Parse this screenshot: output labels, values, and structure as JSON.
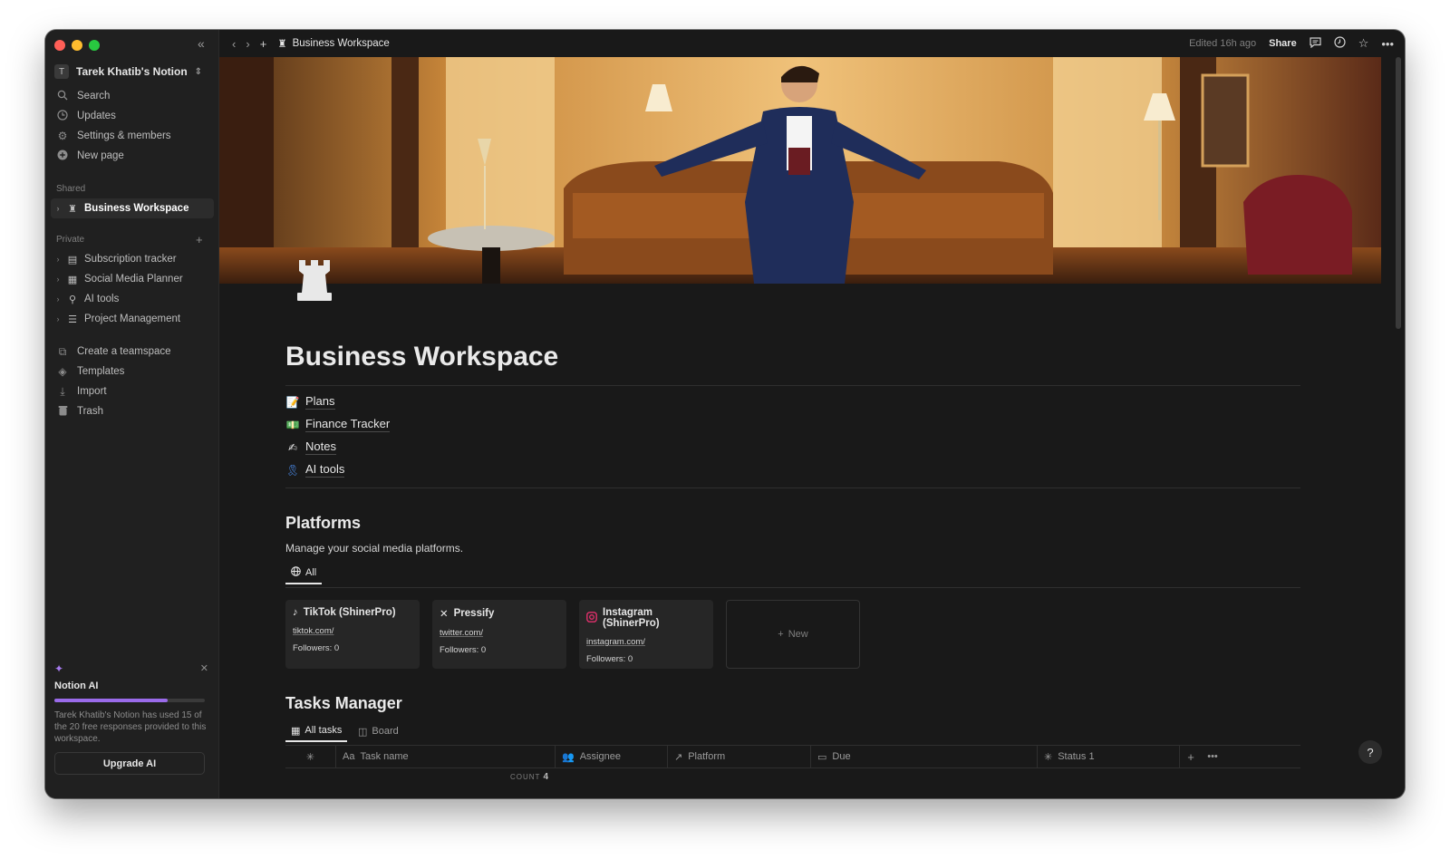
{
  "workspace": {
    "avatar_letter": "T",
    "name": "Tarek Khatib's Notion"
  },
  "sidebar": {
    "nav": [
      {
        "label": "Search",
        "icon": "search-icon"
      },
      {
        "label": "Updates",
        "icon": "clock-icon"
      },
      {
        "label": "Settings & members",
        "icon": "gear-icon"
      },
      {
        "label": "New page",
        "icon": "plus-circle-icon"
      }
    ],
    "shared_label": "Shared",
    "shared_pages": [
      {
        "label": "Business Workspace",
        "icon": "rook-icon"
      }
    ],
    "private_label": "Private",
    "private_pages": [
      {
        "label": "Subscription tracker",
        "icon": "card-icon"
      },
      {
        "label": "Social Media Planner",
        "icon": "table-icon"
      },
      {
        "label": "AI tools",
        "icon": "ribbon-icon"
      },
      {
        "label": "Project Management",
        "icon": "gantt-icon"
      }
    ],
    "bottom": [
      {
        "label": "Create a teamspace",
        "icon": "teamspace-icon"
      },
      {
        "label": "Templates",
        "icon": "shapes-icon"
      },
      {
        "label": "Import",
        "icon": "download-icon"
      },
      {
        "label": "Trash",
        "icon": "trash-icon"
      }
    ],
    "ai": {
      "title": "Notion AI",
      "usage_fraction": 0.75,
      "description": "Tarek Khatib's Notion has used 15 of the 20 free responses provided to this workspace.",
      "button": "Upgrade AI"
    }
  },
  "topbar": {
    "breadcrumb": "Business Workspace",
    "edited": "Edited 16h ago",
    "share": "Share"
  },
  "page": {
    "title": "Business Workspace",
    "links": [
      {
        "label": "Plans",
        "icon": "memo-icon"
      },
      {
        "label": "Finance Tracker",
        "icon": "money-icon"
      },
      {
        "label": "Notes",
        "icon": "writing-hand-icon"
      },
      {
        "label": "AI tools",
        "icon": "ribbon-icon"
      }
    ],
    "platforms": {
      "heading": "Platforms",
      "description": "Manage your social media platforms.",
      "tab": "All",
      "cards": [
        {
          "title": "TikTok (ShinerPro)",
          "url": "tiktok.com/",
          "followers": "Followers: 0",
          "icon": "tiktok-icon"
        },
        {
          "title": "Pressify",
          "url": "twitter.com/",
          "followers": "Followers: 0",
          "icon": "x-icon"
        },
        {
          "title": "Instagram (ShinerPro)",
          "url": "instagram.com/",
          "followers": "Followers: 0",
          "icon": "instagram-icon"
        }
      ],
      "new_label": "New"
    },
    "tasks": {
      "heading": "Tasks Manager",
      "tabs": [
        "All tasks",
        "Board"
      ],
      "columns": [
        "Task name",
        "Assignee",
        "Platform",
        "Due",
        "Status 1"
      ],
      "task_name_prefix": "Aa",
      "count_label": "COUNT",
      "count_value": "4"
    }
  },
  "help": "?",
  "colors": {
    "background": "#191919",
    "sidebar": "#202020",
    "accent": "#9a6bea"
  }
}
